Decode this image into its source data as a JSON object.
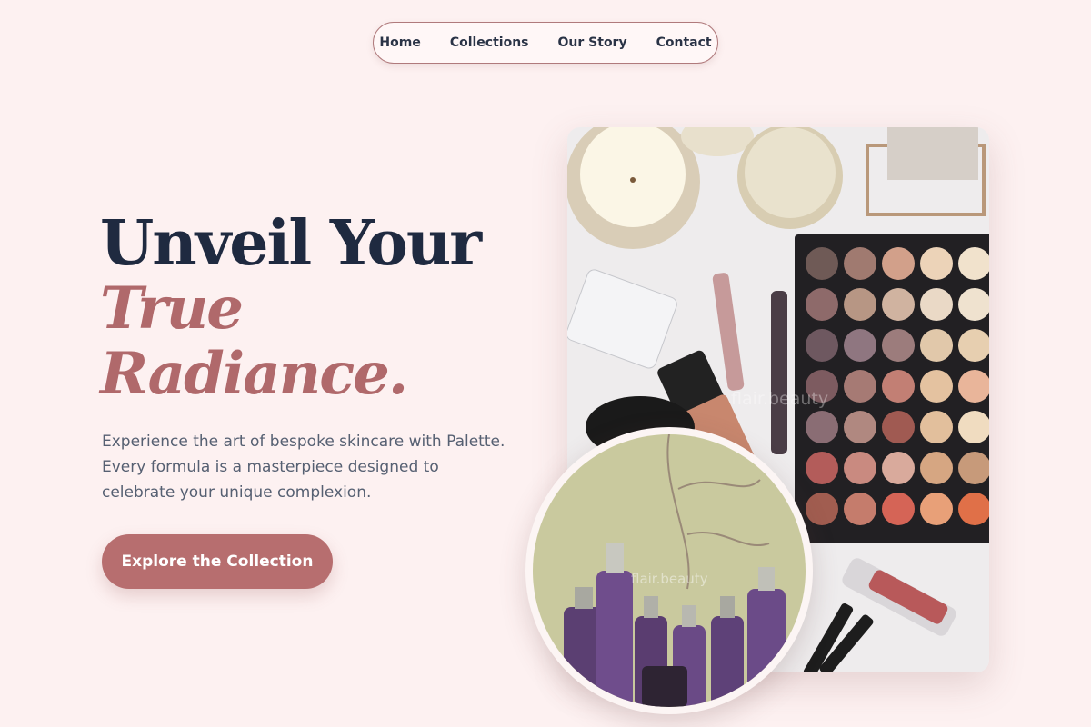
{
  "nav": {
    "items": [
      {
        "label": "Home"
      },
      {
        "label": "Collections"
      },
      {
        "label": "Our Story"
      },
      {
        "label": "Contact"
      }
    ]
  },
  "hero": {
    "title_line1": "Unveil Your",
    "title_line2": "True",
    "title_line3": "Radiance.",
    "description_lines": [
      "Experience the art of bespoke skincare with Palette.",
      "Every formula is a masterpiece designed to",
      "celebrate your unique complexion."
    ],
    "cta_label": "Explore the Collection"
  },
  "images": {
    "main_watermark": "flair.beauty",
    "circle_watermark": "flair.beauty"
  },
  "colors": {
    "background": "#fdf1f1",
    "heading": "#1f2a40",
    "accent": "#b0696b",
    "button": "#b76e6f",
    "body_text": "#566072"
  }
}
